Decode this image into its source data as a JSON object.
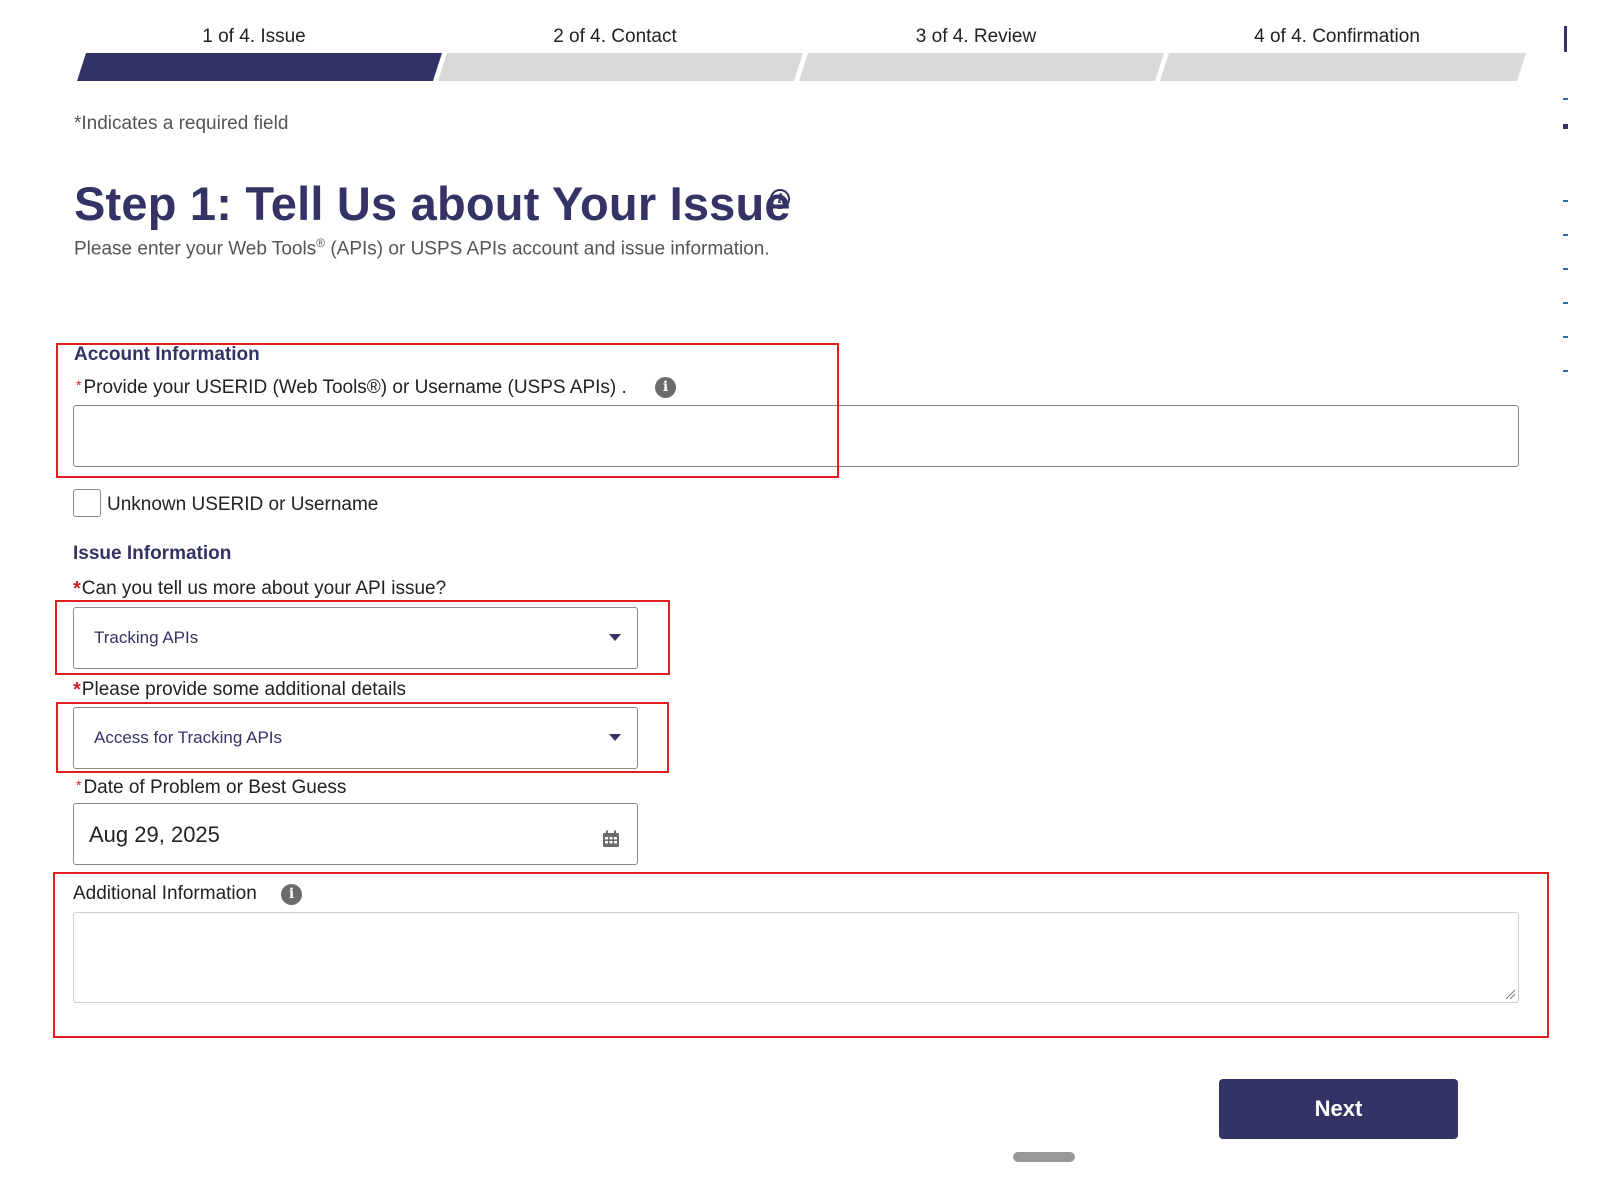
{
  "stepper": {
    "steps": [
      {
        "label": "1 of 4. Issue",
        "active": true
      },
      {
        "label": "2 of 4. Contact",
        "active": false
      },
      {
        "label": "3 of 4. Review",
        "active": false
      },
      {
        "label": "4 of 4. Confirmation",
        "active": false
      }
    ]
  },
  "required_note": "*Indicates a required field",
  "page": {
    "title": "Step 1: Tell Us about Your Issue",
    "subtitle_pre": "Please enter your Web Tools",
    "subtitle_reg": "®",
    "subtitle_post": " (APIs) or USPS APIs account and issue information."
  },
  "account": {
    "heading": "Account Information",
    "userid_label": "Provide your USERID (Web Tools®) or Username (USPS APIs) .",
    "userid_value": "",
    "unknown_checkbox_label": "Unknown USERID or Username",
    "unknown_checked": false
  },
  "issue": {
    "heading": "Issue Information",
    "api_issue_label": "Can you tell us more about your API issue?",
    "api_issue_value": "Tracking APIs",
    "details_label": "Please provide some additional details",
    "details_value": "Access for Tracking APIs",
    "date_label": "Date of Problem or Best Guess",
    "date_value": "Aug 29, 2025",
    "additional_label": "Additional Information",
    "additional_value": ""
  },
  "actions": {
    "next_label": "Next"
  },
  "colors": {
    "brand_navy": "#333366",
    "inactive_step": "#d9d9d9",
    "required_red": "#d0212c",
    "highlight_red": "#e0201e"
  }
}
